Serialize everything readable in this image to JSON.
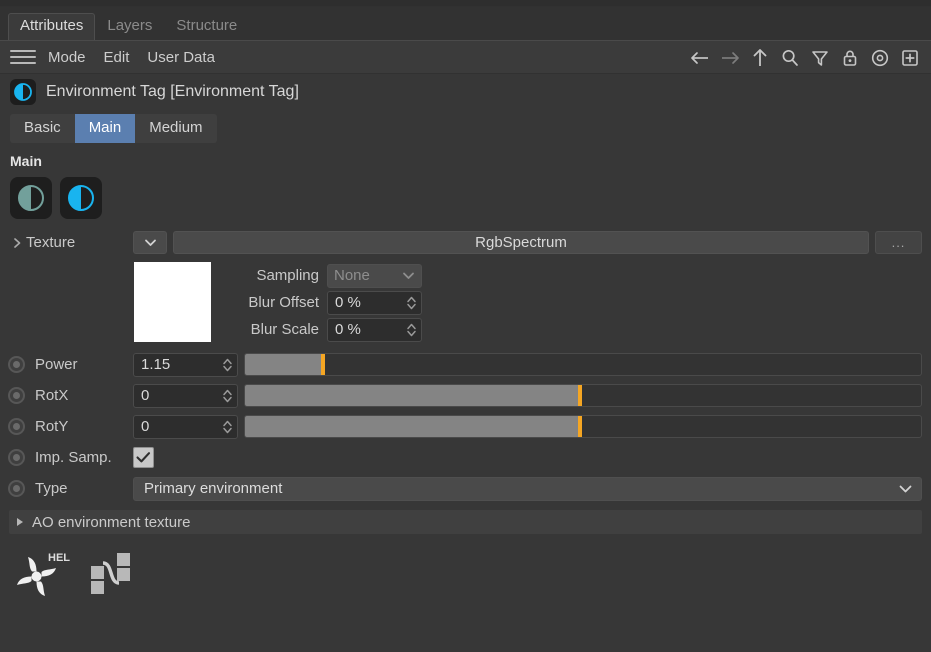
{
  "window": {
    "tabs": [
      {
        "label": "Attributes",
        "active": true
      },
      {
        "label": "Layers",
        "active": false
      },
      {
        "label": "Structure",
        "active": false
      }
    ]
  },
  "menu": {
    "hamburger_icon": "hamburger-icon",
    "items": [
      "Mode",
      "Edit",
      "User Data"
    ],
    "tool_icons": [
      "arrow-left-icon",
      "arrow-right-icon",
      "arrow-up-icon",
      "search-icon",
      "filter-icon",
      "lock-icon",
      "target-icon",
      "add-box-icon"
    ]
  },
  "object": {
    "icon": "environment-tag-icon",
    "title": "Environment Tag [Environment Tag]",
    "section_tabs": [
      {
        "label": "Basic",
        "selected": false
      },
      {
        "label": "Main",
        "selected": true
      },
      {
        "label": "Medium",
        "selected": false
      }
    ]
  },
  "main": {
    "group_label": "Main",
    "icon_buttons": [
      {
        "name": "env-override-off-icon",
        "color": "#72a09b"
      },
      {
        "name": "env-override-on-icon",
        "color": "#19b4ef"
      }
    ],
    "texture": {
      "label": "Texture",
      "expander": "chevron-right-icon",
      "dropdown_icon": "chevron-down-icon",
      "value": "RgbSpectrum",
      "browse_label": "...",
      "thumbnail_color": "#ffffff"
    },
    "sampling": {
      "label": "Sampling",
      "value": "None",
      "disabled": true
    },
    "blur_offset": {
      "label": "Blur Offset",
      "value": "0 %"
    },
    "blur_scale": {
      "label": "Blur Scale",
      "value": "0 %"
    },
    "power": {
      "label": "Power",
      "value": "1.15",
      "slider_percent": 11.5
    },
    "rotx": {
      "label": "RotX",
      "value": "0",
      "slider_percent": 49.5
    },
    "roty": {
      "label": "RotY",
      "value": "0",
      "slider_percent": 49.5
    },
    "imp_samp": {
      "label": "Imp. Samp.",
      "checked": true
    },
    "type": {
      "label": "Type",
      "value": "Primary environment"
    },
    "ao_group": {
      "label": "AO environment texture",
      "expanded": false
    }
  },
  "footer": {
    "help_label": "HELP",
    "help_icon": "chaos-help-icon",
    "node_editor_icon": "node-graph-icon"
  },
  "colors": {
    "accent_blue": "#5b7fb0",
    "slider_handle": "#f5a623",
    "panel_bg": "#373737",
    "cyan": "#19b4ef"
  }
}
